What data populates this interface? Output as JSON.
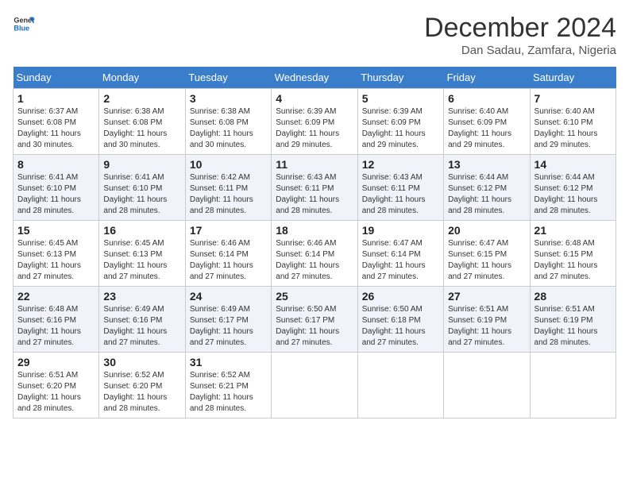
{
  "header": {
    "logo_general": "General",
    "logo_blue": "Blue",
    "month_title": "December 2024",
    "location": "Dan Sadau, Zamfara, Nigeria"
  },
  "days_of_week": [
    "Sunday",
    "Monday",
    "Tuesday",
    "Wednesday",
    "Thursday",
    "Friday",
    "Saturday"
  ],
  "weeks": [
    [
      {
        "day": "1",
        "sunrise": "6:37 AM",
        "sunset": "6:08 PM",
        "daylight": "11 hours and 30 minutes."
      },
      {
        "day": "2",
        "sunrise": "6:38 AM",
        "sunset": "6:08 PM",
        "daylight": "11 hours and 30 minutes."
      },
      {
        "day": "3",
        "sunrise": "6:38 AM",
        "sunset": "6:08 PM",
        "daylight": "11 hours and 30 minutes."
      },
      {
        "day": "4",
        "sunrise": "6:39 AM",
        "sunset": "6:09 PM",
        "daylight": "11 hours and 29 minutes."
      },
      {
        "day": "5",
        "sunrise": "6:39 AM",
        "sunset": "6:09 PM",
        "daylight": "11 hours and 29 minutes."
      },
      {
        "day": "6",
        "sunrise": "6:40 AM",
        "sunset": "6:09 PM",
        "daylight": "11 hours and 29 minutes."
      },
      {
        "day": "7",
        "sunrise": "6:40 AM",
        "sunset": "6:10 PM",
        "daylight": "11 hours and 29 minutes."
      }
    ],
    [
      {
        "day": "8",
        "sunrise": "6:41 AM",
        "sunset": "6:10 PM",
        "daylight": "11 hours and 28 minutes."
      },
      {
        "day": "9",
        "sunrise": "6:41 AM",
        "sunset": "6:10 PM",
        "daylight": "11 hours and 28 minutes."
      },
      {
        "day": "10",
        "sunrise": "6:42 AM",
        "sunset": "6:11 PM",
        "daylight": "11 hours and 28 minutes."
      },
      {
        "day": "11",
        "sunrise": "6:43 AM",
        "sunset": "6:11 PM",
        "daylight": "11 hours and 28 minutes."
      },
      {
        "day": "12",
        "sunrise": "6:43 AM",
        "sunset": "6:11 PM",
        "daylight": "11 hours and 28 minutes."
      },
      {
        "day": "13",
        "sunrise": "6:44 AM",
        "sunset": "6:12 PM",
        "daylight": "11 hours and 28 minutes."
      },
      {
        "day": "14",
        "sunrise": "6:44 AM",
        "sunset": "6:12 PM",
        "daylight": "11 hours and 28 minutes."
      }
    ],
    [
      {
        "day": "15",
        "sunrise": "6:45 AM",
        "sunset": "6:13 PM",
        "daylight": "11 hours and 27 minutes."
      },
      {
        "day": "16",
        "sunrise": "6:45 AM",
        "sunset": "6:13 PM",
        "daylight": "11 hours and 27 minutes."
      },
      {
        "day": "17",
        "sunrise": "6:46 AM",
        "sunset": "6:14 PM",
        "daylight": "11 hours and 27 minutes."
      },
      {
        "day": "18",
        "sunrise": "6:46 AM",
        "sunset": "6:14 PM",
        "daylight": "11 hours and 27 minutes."
      },
      {
        "day": "19",
        "sunrise": "6:47 AM",
        "sunset": "6:14 PM",
        "daylight": "11 hours and 27 minutes."
      },
      {
        "day": "20",
        "sunrise": "6:47 AM",
        "sunset": "6:15 PM",
        "daylight": "11 hours and 27 minutes."
      },
      {
        "day": "21",
        "sunrise": "6:48 AM",
        "sunset": "6:15 PM",
        "daylight": "11 hours and 27 minutes."
      }
    ],
    [
      {
        "day": "22",
        "sunrise": "6:48 AM",
        "sunset": "6:16 PM",
        "daylight": "11 hours and 27 minutes."
      },
      {
        "day": "23",
        "sunrise": "6:49 AM",
        "sunset": "6:16 PM",
        "daylight": "11 hours and 27 minutes."
      },
      {
        "day": "24",
        "sunrise": "6:49 AM",
        "sunset": "6:17 PM",
        "daylight": "11 hours and 27 minutes."
      },
      {
        "day": "25",
        "sunrise": "6:50 AM",
        "sunset": "6:17 PM",
        "daylight": "11 hours and 27 minutes."
      },
      {
        "day": "26",
        "sunrise": "6:50 AM",
        "sunset": "6:18 PM",
        "daylight": "11 hours and 27 minutes."
      },
      {
        "day": "27",
        "sunrise": "6:51 AM",
        "sunset": "6:19 PM",
        "daylight": "11 hours and 27 minutes."
      },
      {
        "day": "28",
        "sunrise": "6:51 AM",
        "sunset": "6:19 PM",
        "daylight": "11 hours and 28 minutes."
      }
    ],
    [
      {
        "day": "29",
        "sunrise": "6:51 AM",
        "sunset": "6:20 PM",
        "daylight": "11 hours and 28 minutes."
      },
      {
        "day": "30",
        "sunrise": "6:52 AM",
        "sunset": "6:20 PM",
        "daylight": "11 hours and 28 minutes."
      },
      {
        "day": "31",
        "sunrise": "6:52 AM",
        "sunset": "6:21 PM",
        "daylight": "11 hours and 28 minutes."
      },
      null,
      null,
      null,
      null
    ]
  ]
}
